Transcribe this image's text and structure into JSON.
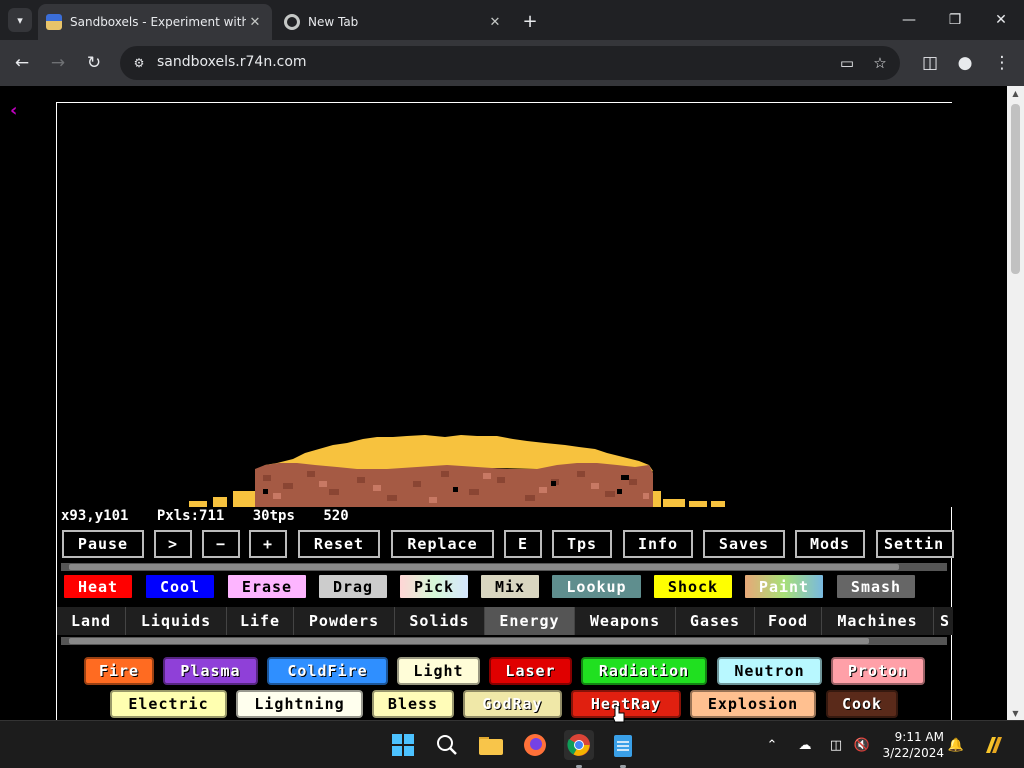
{
  "browser": {
    "tabs": [
      {
        "title": "Sandboxels - Experiment with P",
        "active": true
      },
      {
        "title": "New Tab",
        "active": false
      }
    ],
    "url": "sandboxels.r74n.com",
    "window_controls": [
      "minimize-icon",
      "restore-icon",
      "close-icon"
    ]
  },
  "game": {
    "stats": {
      "coords": "x93,y101",
      "pixels": "Pxls:711",
      "tps": "30tps",
      "tick": "520"
    },
    "controls": [
      {
        "label": "Pause",
        "name": "pause-button"
      },
      {
        "label": ">",
        "name": "step-button"
      },
      {
        "label": "−",
        "name": "decrease-size-button"
      },
      {
        "label": "+",
        "name": "increase-size-button"
      },
      {
        "label": "Reset",
        "name": "reset-button"
      },
      {
        "label": "Replace",
        "name": "replace-button"
      },
      {
        "label": "E",
        "name": "element-search-button"
      },
      {
        "label": "Tps",
        "name": "tps-button"
      },
      {
        "label": "Info",
        "name": "info-button"
      },
      {
        "label": "Saves",
        "name": "saves-button"
      },
      {
        "label": "Mods",
        "name": "mods-button"
      },
      {
        "label": "Settin",
        "name": "settings-button"
      }
    ],
    "tools": [
      {
        "label": "Heat",
        "bg": "#ff0000",
        "fg": "#ffffff"
      },
      {
        "label": "Cool",
        "bg": "#0000ff",
        "fg": "#ffffff"
      },
      {
        "label": "Erase",
        "bg": "#fdb5ff",
        "fg": "#000000"
      },
      {
        "label": "Drag",
        "bg": "#cccccc",
        "fg": "#000000"
      },
      {
        "label": "Pick",
        "bg": "#d8f0d0",
        "fg": "#000000"
      },
      {
        "label": "Mix",
        "bg": "#d9d6c0",
        "fg": "#000000"
      },
      {
        "label": "Lookup",
        "bg": "#5f8e8e",
        "fg": "#ffffff"
      },
      {
        "label": "Shock",
        "bg": "#ffff00",
        "fg": "#000000"
      },
      {
        "label": "Paint",
        "bg": "#e7b878",
        "fg": "#ffffff"
      },
      {
        "label": "Smash",
        "bg": "#666666",
        "fg": "#ffffff"
      }
    ],
    "categories": [
      {
        "label": "Land"
      },
      {
        "label": "Liquids"
      },
      {
        "label": "Life"
      },
      {
        "label": "Powders"
      },
      {
        "label": "Solids"
      },
      {
        "label": "Energy",
        "selected": true
      },
      {
        "label": "Weapons"
      },
      {
        "label": "Gases"
      },
      {
        "label": "Food"
      },
      {
        "label": "Machines"
      },
      {
        "label": "S"
      }
    ],
    "elements_row1": [
      {
        "label": "Fire",
        "bg": "#ff6b21",
        "fg": "#ffffff"
      },
      {
        "label": "Plasma",
        "bg": "#8f40d8",
        "fg": "#ffffff"
      },
      {
        "label": "ColdFire",
        "bg": "#2f8fff",
        "fg": "#ffffff"
      },
      {
        "label": "Light",
        "bg": "#fffdd8",
        "fg": "#000000"
      },
      {
        "label": "Laser",
        "bg": "#e00000",
        "fg": "#ffffff"
      },
      {
        "label": "Radiation",
        "bg": "#20e020",
        "fg": "#ffffff"
      },
      {
        "label": "Neutron",
        "bg": "#b8f8ff",
        "fg": "#000000"
      },
      {
        "label": "Proton",
        "bg": "#ffa0a8",
        "fg": "#ffffff"
      }
    ],
    "elements_row2": [
      {
        "label": "Electric",
        "bg": "#ffffb0",
        "fg": "#000000"
      },
      {
        "label": "Lightning",
        "bg": "#ffffee",
        "fg": "#000000"
      },
      {
        "label": "Bless",
        "bg": "#fffcb8",
        "fg": "#000000"
      },
      {
        "label": "GodRay",
        "bg": "#f0e8a8",
        "fg": "#ffffff"
      },
      {
        "label": "HeatRay",
        "bg": "#e02010",
        "fg": "#ffffff"
      },
      {
        "label": "Explosion",
        "bg": "#ffc090",
        "fg": "#000000"
      },
      {
        "label": "Cook",
        "bg": "#5a2a1a",
        "fg": "#ffffff"
      }
    ]
  },
  "taskbar": {
    "apps": [
      "windows-start-icon",
      "search-icon",
      "file-explorer-icon",
      "firefox-icon",
      "chrome-icon",
      "notepad-icon"
    ],
    "time": "9:11 AM",
    "date": "3/22/2024"
  }
}
